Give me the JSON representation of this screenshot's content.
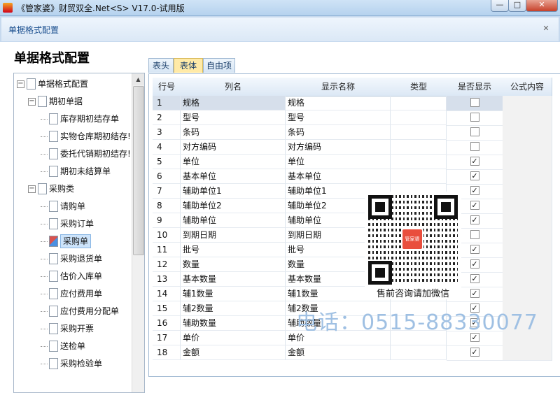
{
  "window": {
    "title": "《管家婆》财贸双全.Net<S> V17.0-试用版",
    "min_label": "—",
    "max_label": "□",
    "close_label": "✕"
  },
  "dialog": {
    "header_title": "单据格式配置",
    "close_label": "✕",
    "page_title": "单据格式配置"
  },
  "tree": {
    "root": "单据格式配置",
    "groups": [
      {
        "label": "期初单据",
        "items": [
          "库存期初结存单",
          "实物仓库期初结存!",
          "委托代销期初结存!",
          "期初未结算单"
        ]
      },
      {
        "label": "采购类",
        "items": [
          "请购单",
          "采购订单",
          "采购单",
          "采购退货单",
          "估价入库单",
          "应付费用单",
          "应付费用分配单",
          "采购开票",
          "送检单",
          "采购检验单"
        ]
      }
    ],
    "selected": "采购单"
  },
  "tabs": [
    "表头",
    "表体",
    "自由项"
  ],
  "active_tab": "表体",
  "grid": {
    "columns": [
      "行号",
      "列名",
      "显示名称",
      "类型",
      "是否显示",
      "公式内容"
    ],
    "rows": [
      {
        "n": "1",
        "name": "规格",
        "display": "规格",
        "show": false
      },
      {
        "n": "2",
        "name": "型号",
        "display": "型号",
        "show": false
      },
      {
        "n": "3",
        "name": "条码",
        "display": "条码",
        "show": false
      },
      {
        "n": "4",
        "name": "对方编码",
        "display": "对方编码",
        "show": false
      },
      {
        "n": "5",
        "name": "单位",
        "display": "单位",
        "show": true
      },
      {
        "n": "6",
        "name": "基本单位",
        "display": "基本单位",
        "show": true
      },
      {
        "n": "7",
        "name": "辅助单位1",
        "display": "辅助单位1",
        "show": true
      },
      {
        "n": "8",
        "name": "辅助单位2",
        "display": "辅助单位2",
        "show": true
      },
      {
        "n": "9",
        "name": "辅助单位",
        "display": "辅助单位",
        "show": true
      },
      {
        "n": "10",
        "name": "到期日期",
        "display": "到期日期",
        "show": false
      },
      {
        "n": "11",
        "name": "批号",
        "display": "批号",
        "show": true
      },
      {
        "n": "12",
        "name": "数量",
        "display": "数量",
        "show": true
      },
      {
        "n": "13",
        "name": "基本数量",
        "display": "基本数量",
        "show": true
      },
      {
        "n": "14",
        "name": "辅1数量",
        "display": "辅1数量",
        "show": true
      },
      {
        "n": "15",
        "name": "辅2数量",
        "display": "辅2数量",
        "show": true
      },
      {
        "n": "16",
        "name": "辅助数量",
        "display": "辅助数量",
        "show": true
      },
      {
        "n": "17",
        "name": "单价",
        "display": "单价",
        "show": true
      },
      {
        "n": "18",
        "name": "金额",
        "display": "金额",
        "show": true
      }
    ]
  },
  "watermark": {
    "qr_logo_text": "管家婆",
    "qr_caption": "售前咨询请加微信",
    "phone": "电话：0515-88330077"
  }
}
